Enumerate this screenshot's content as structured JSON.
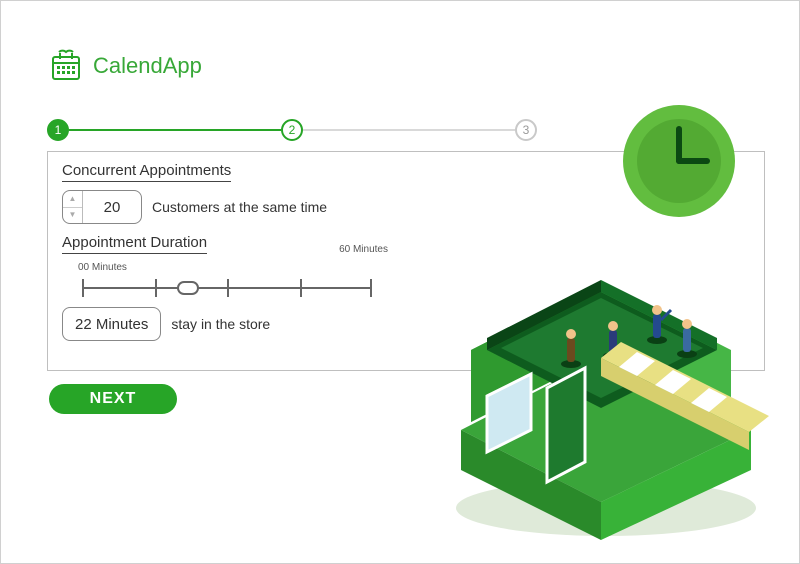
{
  "app": {
    "name": "CalendApp"
  },
  "stepper": {
    "steps": [
      {
        "label": "1",
        "state": "active"
      },
      {
        "label": "2",
        "state": "current"
      },
      {
        "label": "3",
        "state": "pending"
      }
    ]
  },
  "concurrent": {
    "heading": "Concurrent Appointments",
    "value": "20",
    "suffix": "Customers at the same time"
  },
  "duration": {
    "heading": "Appointment Duration",
    "min_label": "00 Minutes",
    "max_label": "60 Minutes",
    "value_display": "22 Minutes",
    "suffix": "stay in the store",
    "slider": {
      "min": 0,
      "max": 60,
      "value": 22
    }
  },
  "actions": {
    "next": "NEXT"
  },
  "colors": {
    "brand": "#27a527"
  }
}
